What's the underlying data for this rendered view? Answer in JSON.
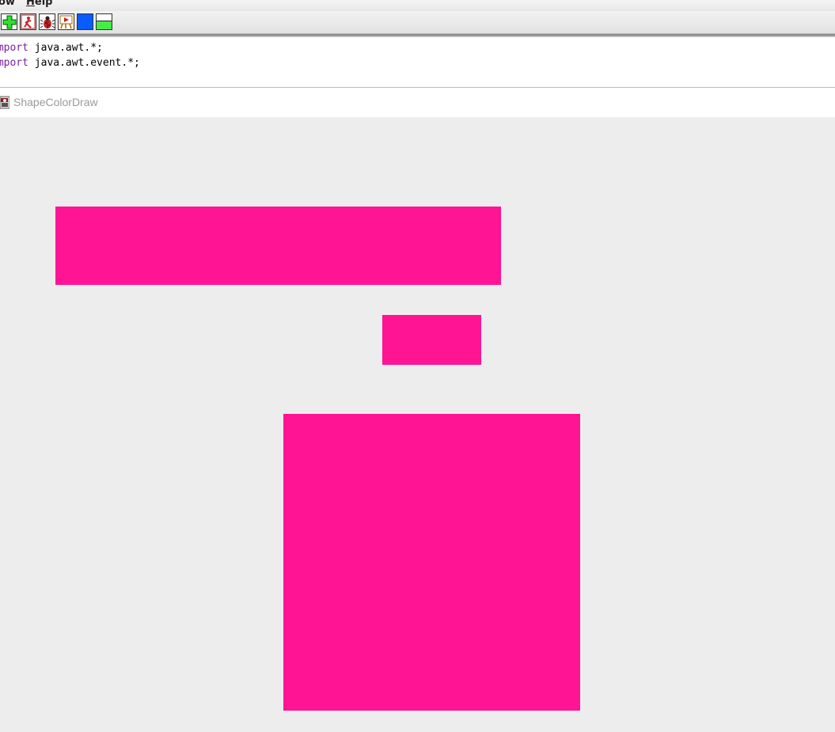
{
  "menu": {
    "items": [
      {
        "label": "ow"
      },
      {
        "label": "Help"
      }
    ]
  },
  "toolbar": {
    "buttons": [
      {
        "name": "new-icon",
        "color": "#22cc22"
      },
      {
        "name": "run-icon",
        "color": "#cc2222"
      },
      {
        "name": "debug-bug-icon",
        "color": "#cc2222"
      },
      {
        "name": "applet-run-icon",
        "color": "#cc7a00"
      },
      {
        "name": "blue-square-icon",
        "color": "#0a5cff"
      },
      {
        "name": "split-panel-icon",
        "color": "#44ee44"
      }
    ]
  },
  "editor": {
    "lines": [
      {
        "keyword": "import",
        "rest": " java.awt.*;"
      },
      {
        "keyword": "import",
        "rest": " java.awt.event.*;"
      }
    ],
    "keyword_color": "#7a1fa2"
  },
  "frame": {
    "title": "ShapeColorDraw",
    "canvas_color": "#ededed"
  },
  "shapes": {
    "fill_color": "#ff1493",
    "count": 3
  }
}
